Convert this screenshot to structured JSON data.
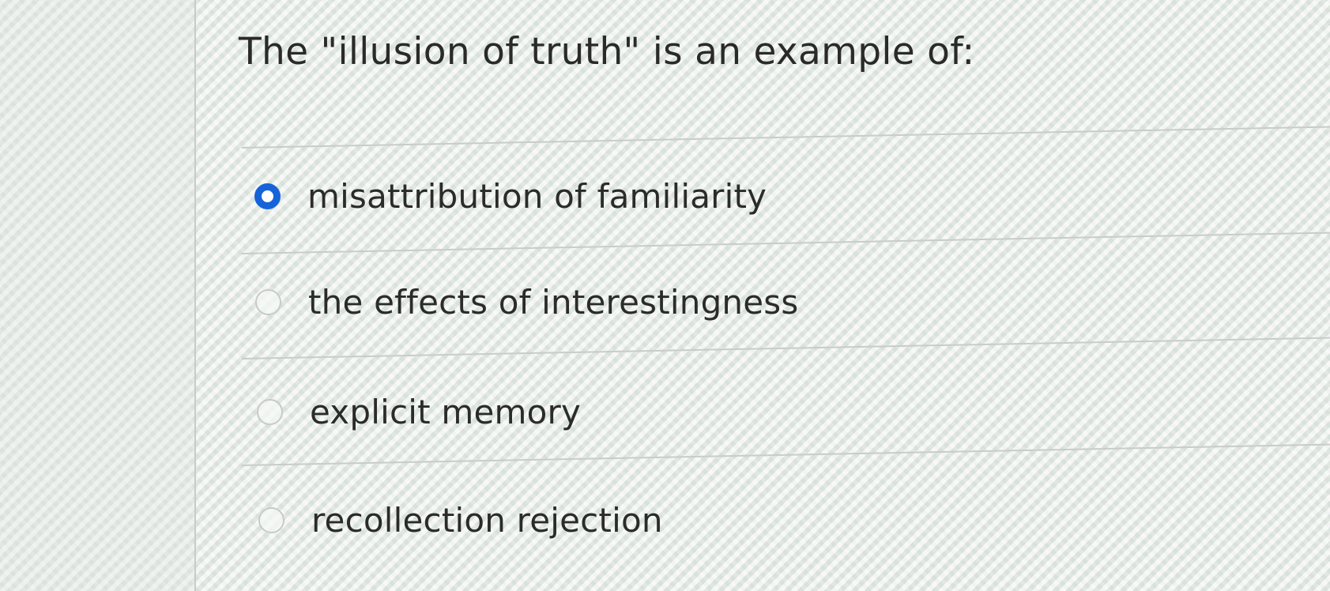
{
  "question": {
    "title": "The \"illusion of truth\" is an example of:"
  },
  "options": [
    {
      "label": "misattribution of familiarity",
      "selected": true
    },
    {
      "label": "the effects of interestingness",
      "selected": false
    },
    {
      "label": "explicit memory",
      "selected": false
    },
    {
      "label": "recollection rejection",
      "selected": false
    }
  ],
  "colors": {
    "accent": "#1662d8",
    "text": "#2b2b2b",
    "divider": "#c9ccc9"
  }
}
